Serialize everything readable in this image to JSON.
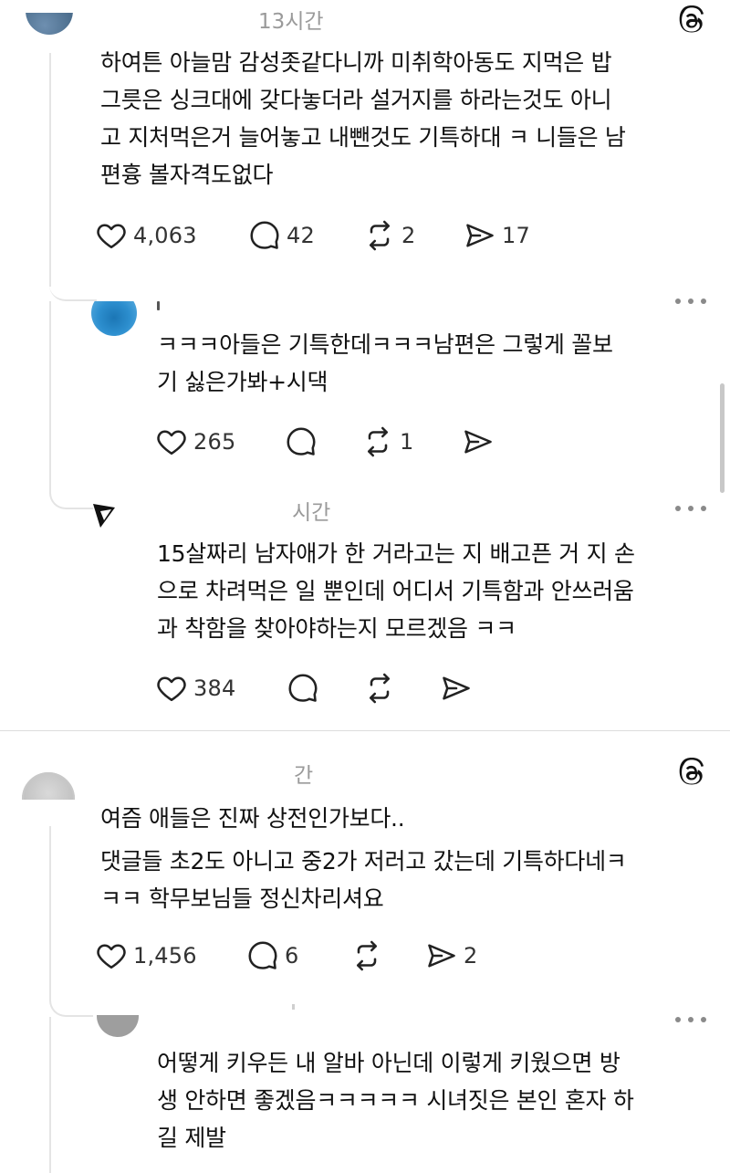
{
  "posts": [
    {
      "time": "13시간",
      "username": "",
      "text_lines": [
        "하여튼 아늘맘 감성좃같다니까 미취학아동도 지먹은 밥",
        "그릇은 싱크대에 갖다놓더라 설거지를 하라는것도 아니",
        "고 지처먹은거 늘어놓고 내뺀것도 기특하대 ㅋ 니들은 남",
        "편흉 볼자격도없다"
      ],
      "likes": "4,063",
      "comments": "42",
      "reposts": "2",
      "shares": "17"
    },
    {
      "time": "",
      "username": "",
      "text_lines": [
        "ㅋㅋㅋ아들은 기특한데ㅋㅋㅋ남편은 그렇게 꼴보",
        "기 싫은가봐+시댁"
      ],
      "likes": "265",
      "comments": "",
      "reposts": "1",
      "shares": ""
    },
    {
      "time": "시간",
      "username": "",
      "text_lines": [
        "15살짜리 남자애가 한 거라고는 지 배고픈 거 지 손",
        "으로 차려먹은 일 뿐인데 어디서 기특함과 안쓰러움",
        "과 착함을 찾아야하는지 모르겠음 ㅋㅋ"
      ],
      "likes": "384",
      "comments": "",
      "reposts": "",
      "shares": ""
    },
    {
      "time": "간",
      "username": "",
      "text_lines": [
        "여즘 애들은 진짜 상전인가보다..",
        "댓글들 초2도 아니고 중2가 저러고 갔는데 기특하다네ㅋ",
        "ㅋㅋ 학무보님들 정신차리셔요"
      ],
      "likes": "1,456",
      "comments": "6",
      "reposts": "",
      "shares": "2"
    },
    {
      "time": "",
      "username": "",
      "text_lines": [
        "어떻게 키우든 내 알바 아닌데 이렇게 키웠으면 방",
        "생 안하면 좋겠음ㅋㅋㅋㅋㅋ 시녀짓은 본인 혼자 하",
        "길 제발"
      ],
      "likes": "",
      "comments": "",
      "reposts": "",
      "shares": ""
    }
  ],
  "icons": {
    "like": "heart-icon",
    "comment": "comment-bubble-icon",
    "repost": "repost-icon",
    "share": "send-icon",
    "more": "more-dots-icon",
    "brand": "threads-logo-icon"
  }
}
